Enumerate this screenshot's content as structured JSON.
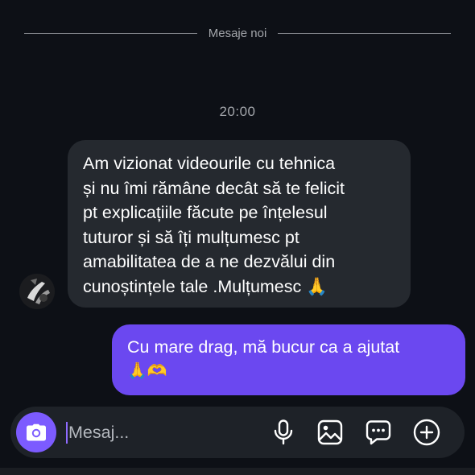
{
  "divider": {
    "label": "Mesaje noi"
  },
  "timestamp": "20:00",
  "messages": {
    "incoming": {
      "lines": [
        "Am vizionat videourile cu tehnica",
        "și nu îmi rămâne decât să te felicit",
        "pt explicațiile făcute pe înțelesul",
        "tuturor și să îți mulțumesc pt",
        "amabilitatea de a ne dezvălui din",
        "cunoștințele tale .Mulțumesc 🙏"
      ]
    },
    "outgoing": {
      "text": "Cu mare drag, mă bucur ca a ajutat",
      "emojis": "🙏🫶"
    }
  },
  "composer": {
    "placeholder": "Mesaj...",
    "value": "",
    "icons": [
      "camera-icon",
      "microphone-icon",
      "gallery-icon",
      "sticker-icon",
      "plus-icon"
    ]
  },
  "colors": {
    "background": "#0d1016",
    "incoming_bubble": "#25292f",
    "outgoing_bubble": "#6b48f0",
    "accent": "#7c5bff"
  }
}
